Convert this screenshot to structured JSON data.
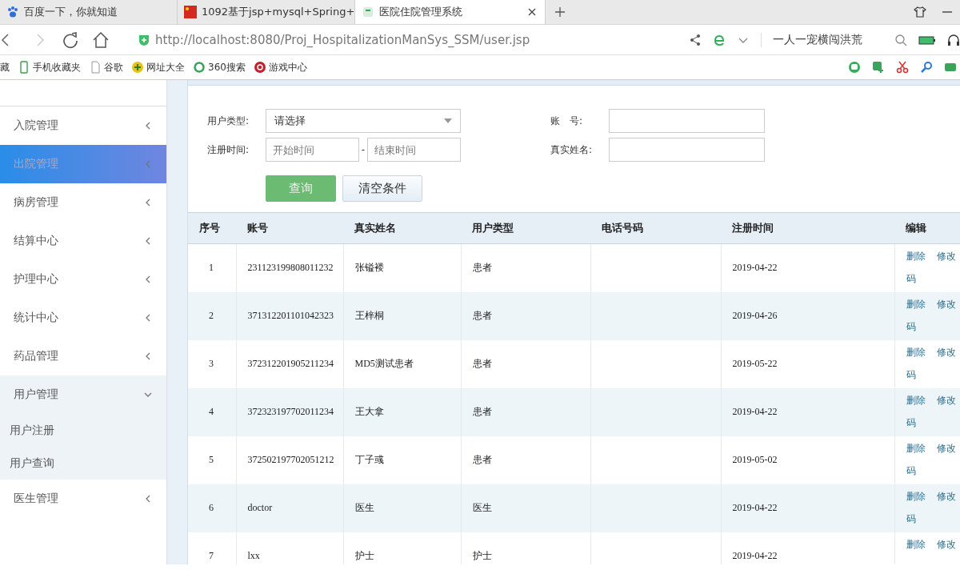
{
  "browser": {
    "tabs": [
      {
        "title": "百度一下，你就知道",
        "selected": false
      },
      {
        "title": "1092基于jsp+mysql+Spring+",
        "selected": false
      },
      {
        "title": "医院住院管理系统",
        "selected": true
      }
    ],
    "url": "http://localhost:8080/Proj_HospitalizationManSys_SSM/user.jsp",
    "search_text": "一人一宠横闯洪荒",
    "bookmarks": [
      "藏",
      "手机收藏夹",
      "谷歌",
      "网址大全",
      "360搜索",
      "游戏中心"
    ]
  },
  "sidebar": {
    "items": [
      {
        "label": "入院管理",
        "selected": false,
        "expanded": false
      },
      {
        "label": "出院管理",
        "selected": true,
        "expanded": false
      },
      {
        "label": "病房管理",
        "selected": false,
        "expanded": false
      },
      {
        "label": "结算中心",
        "selected": false,
        "expanded": false
      },
      {
        "label": "护理中心",
        "selected": false,
        "expanded": false
      },
      {
        "label": "统计中心",
        "selected": false,
        "expanded": false
      },
      {
        "label": "药品管理",
        "selected": false,
        "expanded": false
      },
      {
        "label": "用户管理",
        "selected": false,
        "expanded": true,
        "children": [
          {
            "label": "用户注册"
          },
          {
            "label": "用户查询"
          }
        ]
      },
      {
        "label": "医生管理",
        "selected": false,
        "expanded": false
      }
    ]
  },
  "search_form": {
    "user_type_label": "用户类型:",
    "user_type_value": "请选择",
    "account_label": "账　号:",
    "reg_time_label": "注册时间:",
    "start_placeholder": "开始时间",
    "separator": "-",
    "end_placeholder": "结束时间",
    "real_name_label": "真实姓名:",
    "query_button": "查询",
    "clear_button": "清空条件"
  },
  "table": {
    "columns": [
      "序号",
      "账号",
      "真实姓名",
      "用户类型",
      "电话号码",
      "注册时间",
      "编辑"
    ],
    "rows": [
      {
        "cells": [
          "1",
          "231123199808011232",
          "张镒褛",
          "患者",
          "",
          "2019-04-22"
        ],
        "actions": [
          "删除",
          "修改",
          "码"
        ]
      },
      {
        "cells": [
          "2",
          "371312201101042323",
          "王梓桐",
          "患者",
          "",
          "2019-04-26"
        ],
        "actions": [
          "删除",
          "修改",
          "码"
        ]
      },
      {
        "cells": [
          "3",
          "372312201905211234",
          "MD5测试患者",
          "患者",
          "",
          "2019-05-22"
        ],
        "actions": [
          "删除",
          "修改",
          "码"
        ]
      },
      {
        "cells": [
          "4",
          "372323197702011234",
          "王大拿",
          "患者",
          "",
          "2019-04-22"
        ],
        "actions": [
          "删除",
          "修改",
          "码"
        ]
      },
      {
        "cells": [
          "5",
          "372502197702051212",
          "丁子彧",
          "患者",
          "",
          "2019-05-02"
        ],
        "actions": [
          "删除",
          "修改",
          "码"
        ]
      },
      {
        "cells": [
          "6",
          "doctor",
          "医生",
          "医生",
          "",
          "2019-04-22"
        ],
        "actions": [
          "删除",
          "修改",
          "码"
        ]
      },
      {
        "cells": [
          "7",
          "lxx",
          "护士",
          "护士",
          "",
          "2019-04-22"
        ],
        "actions": [
          "删除",
          "修改"
        ]
      }
    ]
  }
}
